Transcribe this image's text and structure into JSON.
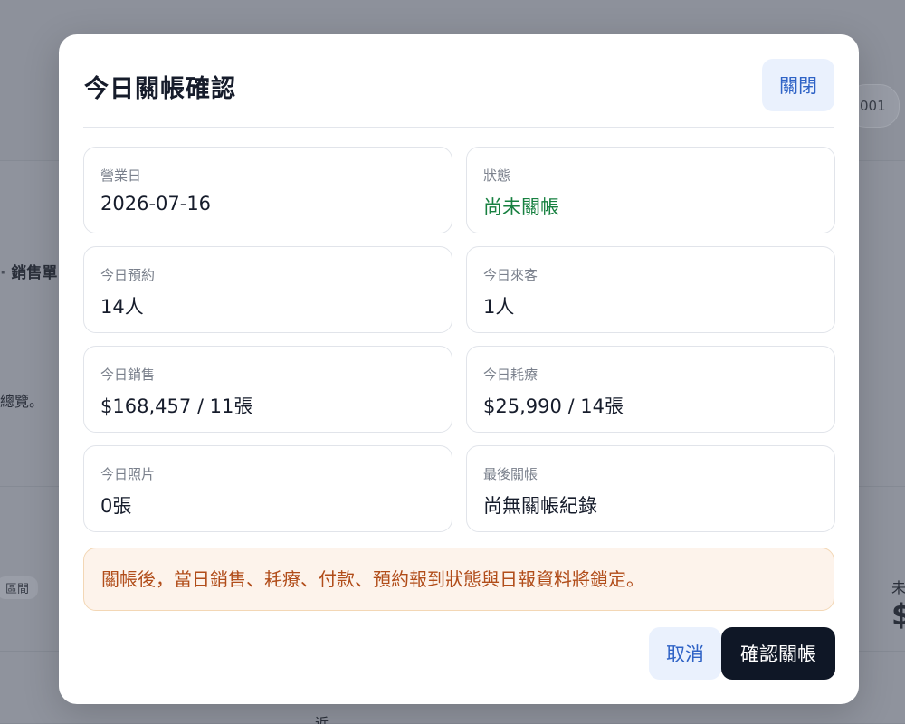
{
  "background": {
    "header_pill": "001",
    "section_heading": "銷售單",
    "overview_text": "總覽。",
    "tag_text": "區間",
    "right_label": "未",
    "right_value": "$",
    "bottom_text": "近"
  },
  "modal": {
    "title": "今日關帳確認",
    "close_label": "關閉",
    "cards": [
      {
        "label": "營業日",
        "value": "2026-07-16"
      },
      {
        "label": "狀態",
        "value": "尚未關帳",
        "status_color": "#178040"
      },
      {
        "label": "今日預約",
        "value": "14人"
      },
      {
        "label": "今日來客",
        "value": "1人"
      },
      {
        "label": "今日銷售",
        "value": "$168,457 / 11張"
      },
      {
        "label": "今日耗療",
        "value": "$25,990 / 14張"
      },
      {
        "label": "今日照片",
        "value": "0張"
      },
      {
        "label": "最後關帳",
        "value": "尚無關帳紀錄"
      }
    ],
    "notice": "關帳後，當日銷售、耗療、付款、預約報到狀態與日報資料將鎖定。",
    "cancel_label": "取消",
    "confirm_label": "確認關帳"
  },
  "colors": {
    "accent": "#2f63c6",
    "primary_button": "#0f1726",
    "status_ok": "#178040",
    "notice_text": "#b14d1a",
    "notice_bg": "#fdf3eb"
  }
}
